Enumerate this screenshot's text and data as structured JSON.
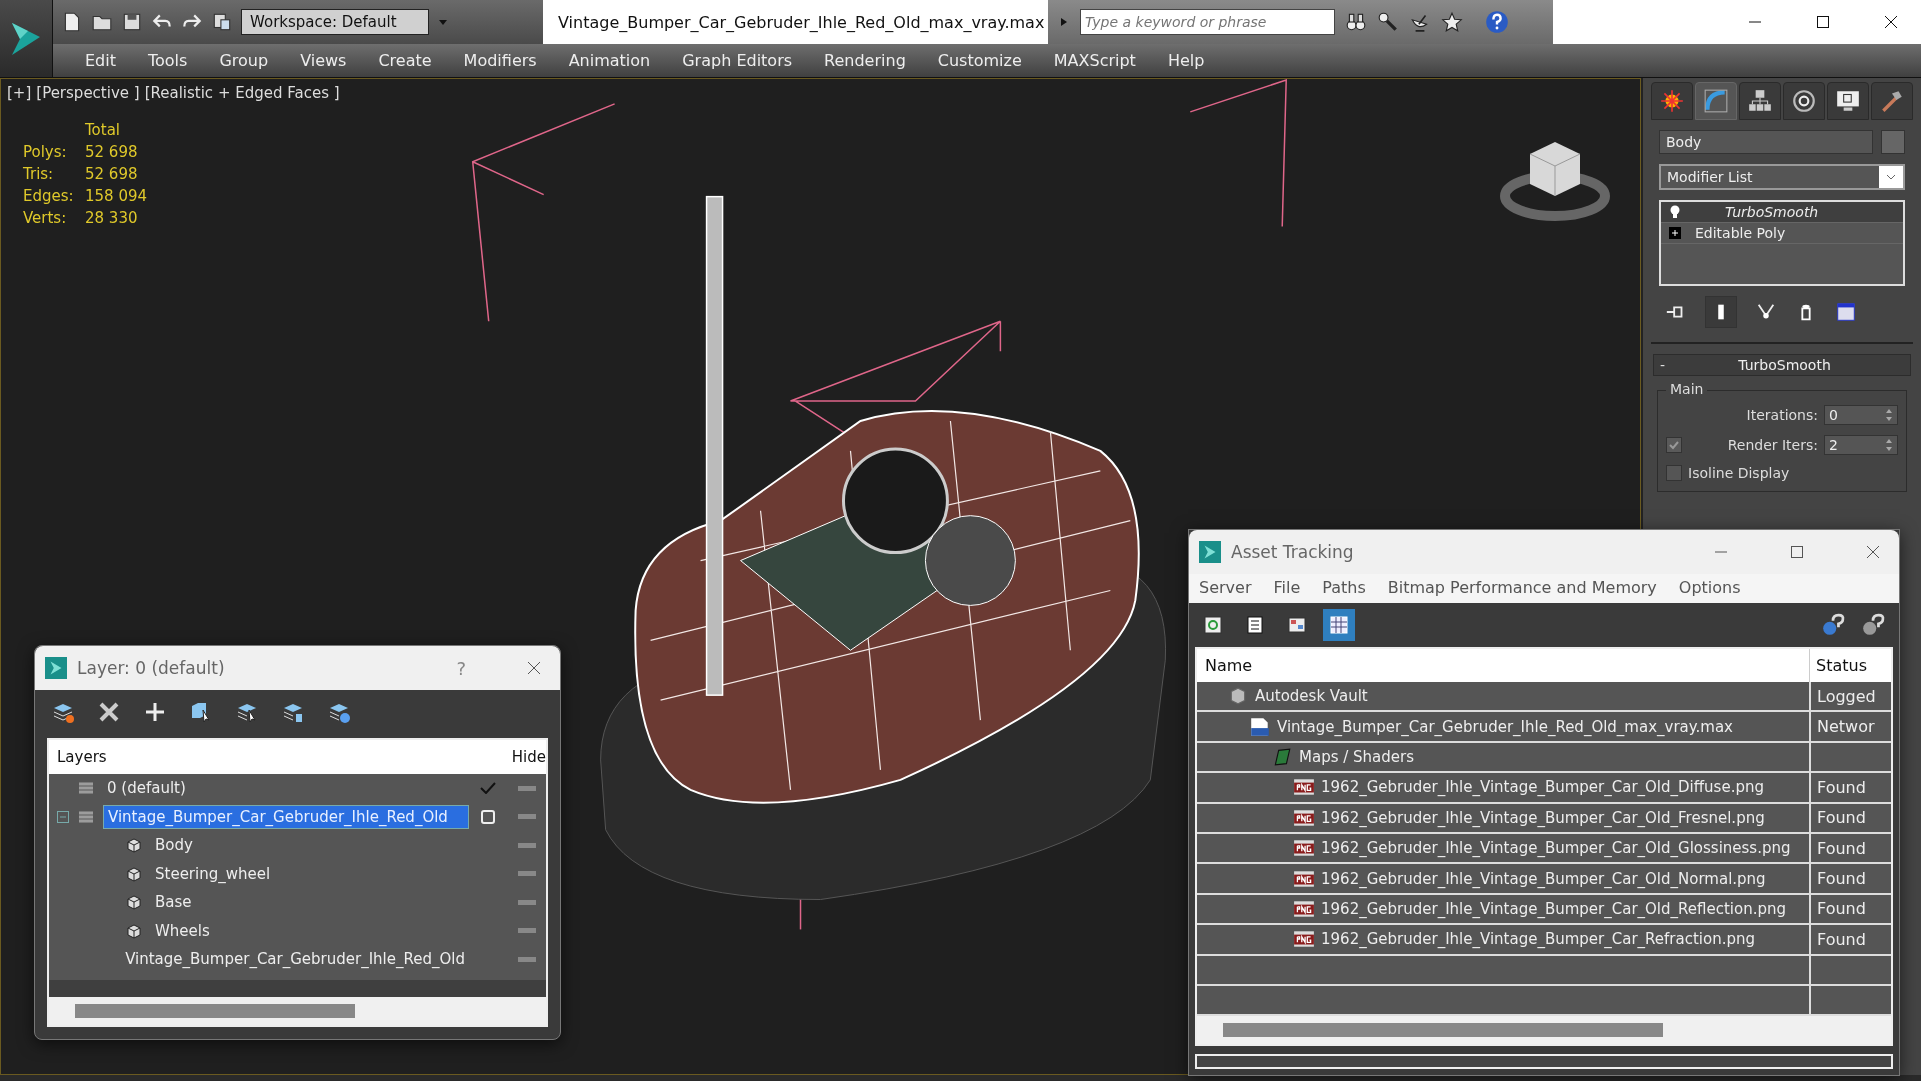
{
  "title_bar": {
    "workspace": "Workspace: Default",
    "file_title": "Vintage_Bumper_Car_Gebruder_Ihle_Red_Old_max_vray.max",
    "search": {
      "placeholder": "Type a keyword or phrase"
    }
  },
  "menu": [
    "Edit",
    "Tools",
    "Group",
    "Views",
    "Create",
    "Modifiers",
    "Animation",
    "Graph Editors",
    "Rendering",
    "Customize",
    "MAXScript",
    "Help"
  ],
  "viewport": {
    "labels": [
      "[+]",
      "[Perspective ]",
      "[Realistic + Edged Faces ]"
    ],
    "stats": {
      "header": "Total",
      "rows": [
        {
          "label": "Polys:",
          "value": "52 698"
        },
        {
          "label": "Tris:",
          "value": "52 698"
        },
        {
          "label": "Edges:",
          "value": "158 094"
        },
        {
          "label": "Verts:",
          "value": "28 330"
        }
      ]
    }
  },
  "command_panel": {
    "tabs": [
      {
        "selected": false
      },
      {
        "selected": true
      },
      {
        "selected": false
      },
      {
        "selected": false
      },
      {
        "selected": false
      },
      {
        "selected": false
      }
    ],
    "object_name": "Body",
    "modifier_list": "Modifier List",
    "stack": [
      {
        "label": "TurboSmooth",
        "kind": "modifier",
        "selected": true
      },
      {
        "label": "Editable Poly",
        "kind": "object",
        "selected": false
      }
    ],
    "rollout": {
      "collapse": "-",
      "title": "TurboSmooth",
      "group": "Main",
      "iterations": {
        "label": "Iterations:",
        "value": "0"
      },
      "render_iters": {
        "label": "Render Iters:",
        "value": "2",
        "checked": true
      },
      "isoline": {
        "label": "Isoline Display",
        "checked": false
      }
    }
  },
  "layer_window": {
    "title": "Layer: 0 (default)",
    "help": "?",
    "columns": [
      "Layers",
      "Hide"
    ],
    "layers": [
      {
        "name": "0 (default)",
        "current": true,
        "selected": false
      },
      {
        "name": "Vintage_Bumper_Car_Gebruder_Ihle_Red_Old",
        "current": false,
        "selected": true,
        "expanded": true,
        "children": [
          {
            "name": "Body"
          },
          {
            "name": "Steering_wheel"
          },
          {
            "name": "Base"
          },
          {
            "name": "Wheels"
          },
          {
            "name": "Vintage_Bumper_Car_Gebruder_Ihle_Red_Old"
          }
        ]
      }
    ]
  },
  "asset_window": {
    "title": "Asset Tracking",
    "menu": [
      "Server",
      "File",
      "Paths",
      "Bitmap Performance and Memory",
      "Options"
    ],
    "views": [
      {
        "selected": false
      },
      {
        "selected": false
      },
      {
        "selected": false
      },
      {
        "selected": true
      }
    ],
    "columns": [
      "Name",
      "Status"
    ],
    "tree": [
      {
        "name": "Autodesk Vault",
        "status": "Logged",
        "kind": "vault",
        "children": [
          {
            "name": "Vintage_Bumper_Car_Gebruder_Ihle_Red_Old_max_vray.max",
            "status": "Networ",
            "kind": "max",
            "children": [
              {
                "name": "Maps / Shaders",
                "kind": "folder",
                "children": [
                  {
                    "name": "1962_Gebruder_Ihle_Vintage_Bumper_Car_Old_Diffuse.png",
                    "status": "Found",
                    "kind": "png"
                  },
                  {
                    "name": "1962_Gebruder_Ihle_Vintage_Bumper_Car_Old_Fresnel.png",
                    "status": "Found",
                    "kind": "png"
                  },
                  {
                    "name": "1962_Gebruder_Ihle_Vintage_Bumper_Car_Old_Glossiness.png",
                    "status": "Found",
                    "kind": "png"
                  },
                  {
                    "name": "1962_Gebruder_Ihle_Vintage_Bumper_Car_Old_Normal.png",
                    "status": "Found",
                    "kind": "png"
                  },
                  {
                    "name": "1962_Gebruder_Ihle_Vintage_Bumper_Car_Old_Reflection.png",
                    "status": "Found",
                    "kind": "png"
                  },
                  {
                    "name": "1962_Gebruder_Ihle_Vintage_Bumper_Car_Refraction.png",
                    "status": "Found",
                    "kind": "png"
                  }
                ]
              }
            ]
          }
        ]
      }
    ]
  }
}
